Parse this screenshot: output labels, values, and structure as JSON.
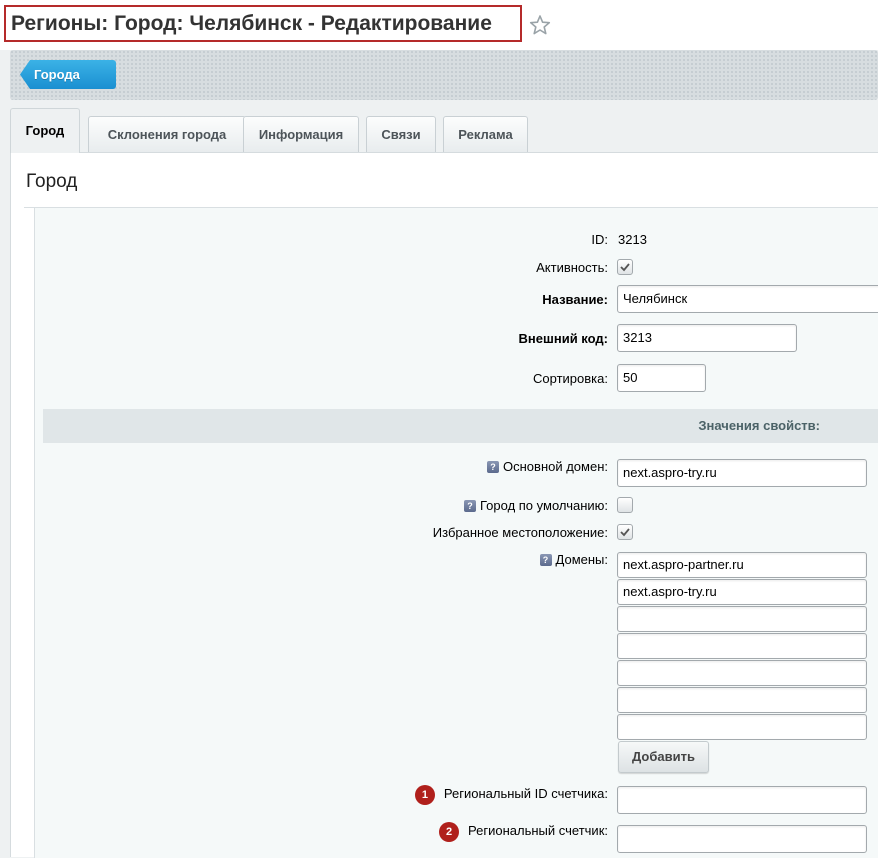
{
  "page": {
    "title": "Регионы: Город: Челябинск - Редактирование",
    "favorite_icon": "star-icon"
  },
  "toolbar": {
    "back_label": "Города"
  },
  "tabs": [
    {
      "label": "Город",
      "active": true
    },
    {
      "label": "Склонения города",
      "active": false
    },
    {
      "label": "Информация",
      "active": false
    },
    {
      "label": "Связи",
      "active": false
    },
    {
      "label": "Реклама",
      "active": false
    }
  ],
  "section": {
    "title": "Город"
  },
  "form": {
    "id_label": "ID:",
    "id_value": "3213",
    "active_label": "Активность:",
    "active_checked": true,
    "name_label": "Название:",
    "name_value": "Челябинск",
    "xml_id_label": "Внешний код:",
    "xml_id_value": "3213",
    "sort_label": "Сортировка:",
    "sort_value": "50"
  },
  "properties": {
    "heading": "Значения свойств:",
    "main_domain_label": "Основной домен:",
    "main_domain_value": "next.aspro-try.ru",
    "default_city_label": "Город по умолчанию:",
    "default_city_checked": false,
    "favorite_location_label": "Избранное местоположение:",
    "favorite_location_checked": true,
    "domains_label": "Домены:",
    "domains": [
      "next.aspro-partner.ru",
      "next.aspro-try.ru",
      "",
      "",
      "",
      ""
    ],
    "add_button": "Добавить",
    "counter_id_label": "Региональный ID счетчика:",
    "counter_id_badge": "1",
    "counter_id_value": "",
    "counter_label": "Региональный счетчик:",
    "counter_badge": "2",
    "counter_value": ""
  },
  "colors": {
    "accent_blue": "#1a8fd1",
    "highlight_red": "#b52a2a",
    "badge_red": "#b0201c"
  }
}
